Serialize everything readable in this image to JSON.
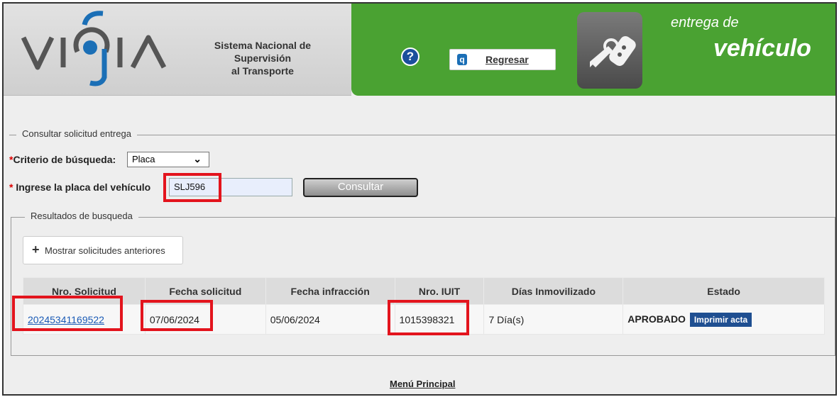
{
  "header": {
    "system_title_lines": [
      "Sistema Nacional de",
      "Supervisión",
      "al Transporte"
    ],
    "back_label": "Regresar",
    "brand_top": "entrega de",
    "brand_main": "vehículo",
    "colors": {
      "brand_green": "#4aa232",
      "logo_blue": "#1b6fb6"
    }
  },
  "consulta": {
    "legend": "Consultar solicitud entrega",
    "criterio_label": "Criterio de búsqueda:",
    "criterio_value": "Placa",
    "placa_label": "Ingrese la placa del vehículo",
    "placa_value": "SLJ596",
    "consultar_label": "Consultar"
  },
  "resultados": {
    "legend": "Resultados de busqueda",
    "prev_button": "Mostrar solicitudes anteriores",
    "columns": [
      "Nro. Solicitud",
      "Fecha solicitud",
      "Fecha infracción",
      "Nro. IUIT",
      "Días Inmovilizado",
      "Estado"
    ],
    "rows": [
      {
        "nro_solicitud": "20245341169522",
        "fecha_solicitud": "07/06/2024",
        "fecha_infraccion": "05/06/2024",
        "nro_iuit": "1015398321",
        "dias": "7 Día(s)",
        "estado": "APROBADO",
        "accion": "Imprimir acta"
      }
    ]
  },
  "footer": {
    "menu_label": "Menú Principal"
  },
  "highlight_color": "#e3141d"
}
